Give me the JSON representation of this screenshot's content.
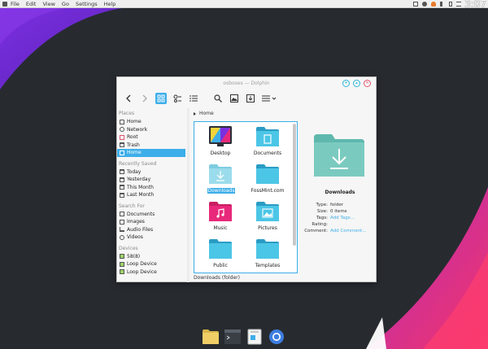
{
  "menubar": {
    "items": [
      "File",
      "Edit",
      "View",
      "Go",
      "Settings",
      "Help"
    ],
    "clock": "3:07"
  },
  "window": {
    "title": "osboxes — Dolphin"
  },
  "sidebar": {
    "places_header": "Places",
    "places": [
      "Home",
      "Network",
      "Root",
      "Trash",
      "Home"
    ],
    "recent_header": "Recently Saved",
    "recent": [
      "Today",
      "Yesterday",
      "This Month",
      "Last Month"
    ],
    "search_header": "Search For",
    "search": [
      "Documents",
      "Images",
      "Audio Files",
      "Videos"
    ],
    "devices_header": "Devices",
    "devices": [
      "58(8)",
      "Loop Device",
      "Loop Device"
    ]
  },
  "breadcrumb": "Home",
  "files": [
    "Desktop",
    "Documents",
    "Downloads",
    "FossMint.com",
    "Music",
    "Pictures",
    "Public",
    "Templates"
  ],
  "status": "Downloads (folder)",
  "info": {
    "name": "Downloads",
    "type_label": "Type:",
    "type_value": "folder",
    "size_label": "Size:",
    "size_value": "0 items",
    "tags_label": "Tags:",
    "tags_value": "Add Tags...",
    "rating_label": "Rating:",
    "comment_label": "Comment:",
    "comment_value": "Add Comment..."
  },
  "colors": {
    "accent": "#3daee9",
    "folder": "#55c8e0",
    "wallpaper_purple": "#6a2bd0",
    "wallpaper_pink": "#e8287a"
  }
}
